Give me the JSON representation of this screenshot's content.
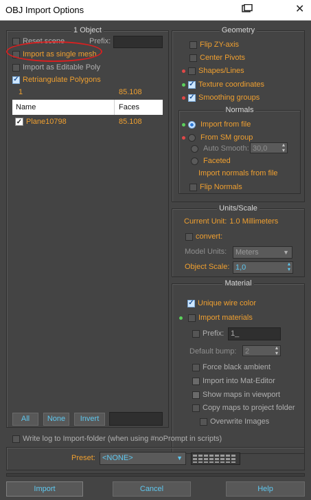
{
  "window": {
    "title": "OBJ Import Options"
  },
  "objects_group": {
    "title": "1 Object",
    "reset_scene": "Reset scene",
    "prefix_label": "Prefix:",
    "import_single_mesh": "Import as single mesh",
    "import_editable_poly": "Import as Editable Poly",
    "retriangulate": "Retriangulate Polygons",
    "count": "1",
    "faces_total": "85.108",
    "table": {
      "headers": [
        "Name",
        "Faces"
      ],
      "rows": [
        {
          "name": "Plane10798",
          "faces": "85.108",
          "checked": true
        }
      ]
    },
    "buttons": {
      "all": "All",
      "none": "None",
      "invert": "Invert"
    }
  },
  "geometry": {
    "title": "Geometry",
    "flip_zy": "Flip ZY-axis",
    "center_pivots": "Center Pivots",
    "shapes_lines": "Shapes/Lines",
    "texture_coords": "Texture coordinates",
    "smoothing_groups": "Smoothing groups",
    "normals": {
      "title": "Normals",
      "import_from_file": "Import from file",
      "from_sm_group": "From SM group",
      "auto_smooth": "Auto Smooth:",
      "auto_smooth_value": "30,0",
      "faceted": "Faceted",
      "import_normals_note": "Import normals from file",
      "flip_normals": "Flip Normals"
    }
  },
  "units": {
    "title": "Units/Scale",
    "current_unit_label": "Current Unit:",
    "current_unit_value": "1.0 Millimeters",
    "convert": "convert:",
    "model_units_label": "Model Units:",
    "model_units_value": "Meters",
    "object_scale_label": "Object Scale:",
    "object_scale_value": "1,0"
  },
  "material": {
    "title": "Material",
    "unique_wire_color": "Unique wire color",
    "import_materials": "Import materials",
    "prefix_label": "Prefix:",
    "prefix_value": "1_",
    "default_bump_label": "Default bump:",
    "default_bump_value": "2",
    "force_black_ambient": "Force black ambient",
    "import_into_mat_editor": "Import into Mat-Editor",
    "show_maps": "Show maps in viewport",
    "copy_maps": "Copy maps to project folder",
    "overwrite_images": "Overwrite Images"
  },
  "footer": {
    "write_log": "Write log to Import-folder (when using #noPrompt in scripts)",
    "preset_label": "Preset:",
    "preset_value": "<NONE>",
    "import_button": "Import",
    "cancel_button": "Cancel",
    "help_button": "Help"
  },
  "colors": {
    "accent_orange": "#f0a030",
    "accent_cyan": "#5fc8f0",
    "annotation_red": "#d82020"
  }
}
